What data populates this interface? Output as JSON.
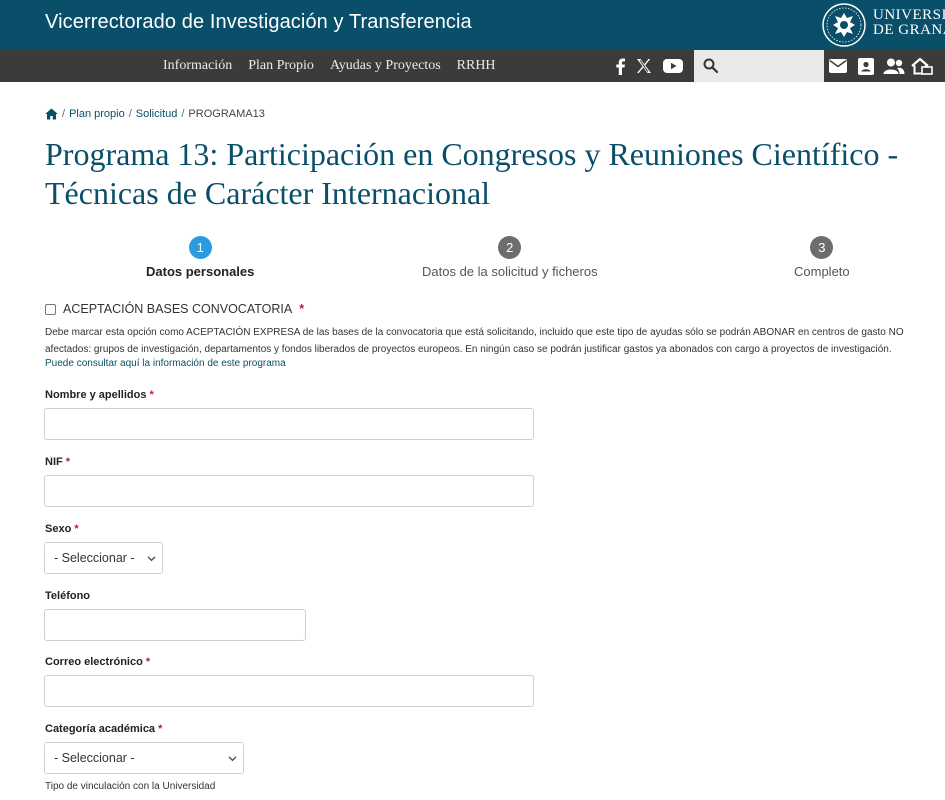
{
  "header": {
    "site_title": "Vicerrectorado de Investigación y Transferencia",
    "university_line1": "UNIVERSIDAD",
    "university_line2": "DE GRANADA"
  },
  "nav": {
    "items": [
      {
        "label": "Información"
      },
      {
        "label": "Plan Propio"
      },
      {
        "label": "Ayudas y Proyectos"
      },
      {
        "label": "RRHH"
      }
    ],
    "search_placeholder": ""
  },
  "breadcrumb": {
    "items": [
      "Plan propio",
      "Solicitud"
    ],
    "current": "PROGRAMA13"
  },
  "page": {
    "title_line1": "Programa 13: Participación en Congresos y Reuniones Científico -",
    "title_line2": "Técnicas de Carácter Internacional"
  },
  "steps": [
    {
      "number": "1",
      "label": "Datos personales",
      "state": "active"
    },
    {
      "number": "2",
      "label": "Datos de la solicitud y ficheros",
      "state": "todo"
    },
    {
      "number": "3",
      "label": "Completo",
      "state": "todo"
    }
  ],
  "acceptance": {
    "label": "ACEPTACIÓN BASES CONVOCATORIA",
    "required_mark": "*",
    "description": "Debe marcar esta opción como ACEPTACIÓN EXPRESA de las bases de la convocatoria que está solicitando, incluido que este tipo de ayudas sólo se podrán ABONAR en centros de gasto NO afectados: grupos de investigación, departamentos y fondos liberados de proyectos europeos. En ningún caso se podrán justificar gastos ya abonados con cargo a proyectos de investigación.",
    "link": "Puede consultar aquí la información de este programa"
  },
  "form": {
    "nombre_label": "Nombre y apellidos",
    "nif_label": "NIF",
    "sexo_label": "Sexo",
    "sexo_value": "- Seleccionar -",
    "telefono_label": "Teléfono",
    "correo_label": "Correo electrónico",
    "categoria_label": "Categoría académica",
    "categoria_value": "- Seleccionar -",
    "categoria_help": "Tipo de vinculación con la Universidad",
    "required_mark": "*"
  },
  "colors": {
    "brand": "#0a4f6a",
    "nav": "#3b3b3b",
    "step_active": "#2b9be0",
    "required": "#c0182f"
  }
}
